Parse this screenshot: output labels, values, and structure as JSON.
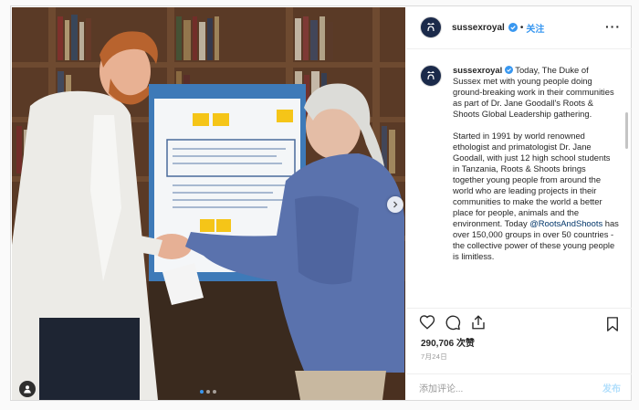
{
  "header": {
    "username": "sussexroyal",
    "separator": "•",
    "follow_label": "关注",
    "more_label": "···"
  },
  "caption": {
    "username": "sussexroyal",
    "intro": "Today, The Duke of Sussex met with young people doing ground-breaking work in their communities as part of Dr. Jane Goodall's Roots & Shoots Global Leadership gathering.",
    "body_before_mention": "Started in 1991 by world renowned ethologist and primatologist Dr. Jane Goodall, with just 12 high school students in Tanzania, Roots & Shoots brings together young people from around the world who are leading projects in their communities to make the world a better place for people, animals and the environment. Today ",
    "mention": "@RootsAndShoots",
    "body_after_mention": " has over 150,000 groups in over 50 countries - the collective power of these young people is limitless."
  },
  "stats": {
    "likes_count": "290,706",
    "likes_suffix": "次赞",
    "date": "7月24日"
  },
  "comment": {
    "placeholder": "添加评论...",
    "post_label": "发布"
  },
  "carousel": {
    "total_slides": 3,
    "active_index": 0
  },
  "icons": {
    "like": "heart-icon",
    "comment": "comment-icon",
    "share": "share-icon",
    "save": "bookmark-icon",
    "verified": "verified-badge-icon",
    "next": "chevron-right-icon",
    "tag": "user-tag-icon"
  },
  "colors": {
    "accent": "#3897f0",
    "verified": "#3897f0",
    "post_disabled": "#b2dffc",
    "border": "#dbdbdb"
  }
}
